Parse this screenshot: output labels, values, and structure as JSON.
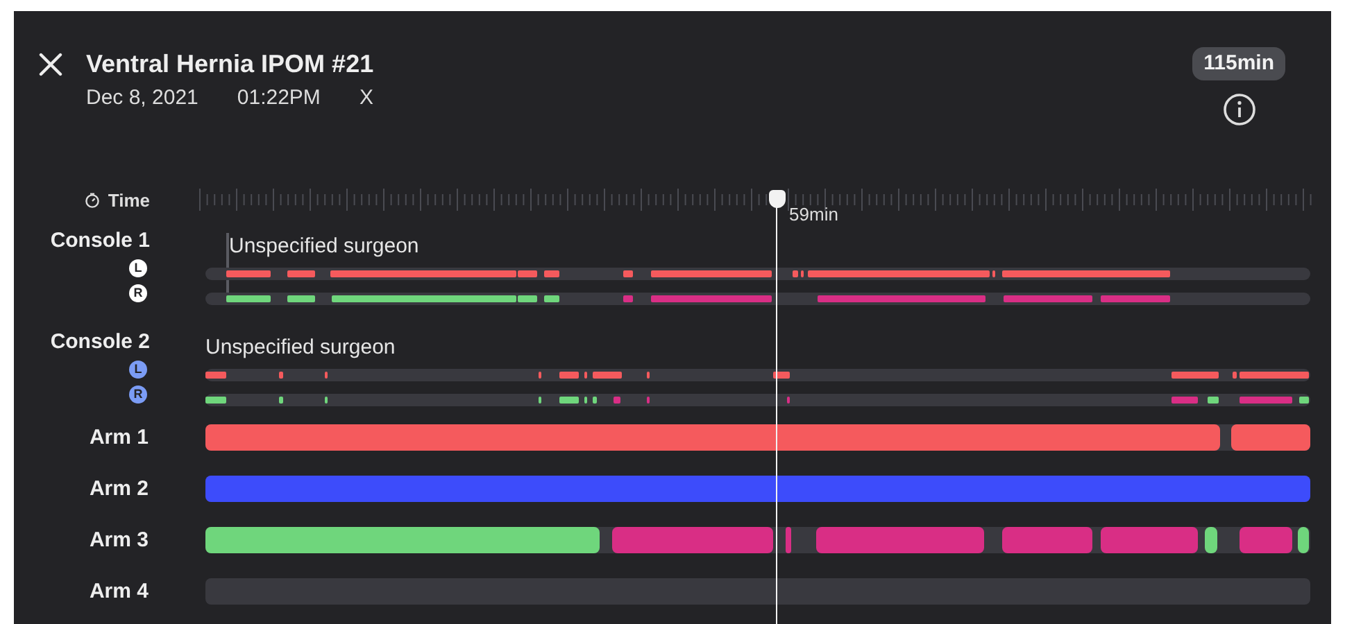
{
  "header": {
    "title": "Ventral Hernia IPOM #21",
    "date": "Dec 8, 2021",
    "time": "01:22PM",
    "tag": "X",
    "duration": "115min"
  },
  "timeline": {
    "time_label": "Time",
    "playhead": {
      "label": "59min"
    },
    "consoles": [
      {
        "name": "Console 1",
        "surgeon": "Unspecified surgeon",
        "hands": [
          {
            "letter": "L",
            "color": "#ffffff"
          },
          {
            "letter": "R",
            "color": "#ffffff"
          }
        ]
      },
      {
        "name": "Console 2",
        "surgeon": "Unspecified surgeon",
        "hands": [
          {
            "letter": "L",
            "color": "#7b9cf5"
          },
          {
            "letter": "R",
            "color": "#7b9cf5"
          }
        ]
      }
    ],
    "arms": [
      {
        "name": "Arm 1"
      },
      {
        "name": "Arm 2"
      },
      {
        "name": "Arm 3"
      },
      {
        "name": "Arm 4"
      }
    ]
  }
}
